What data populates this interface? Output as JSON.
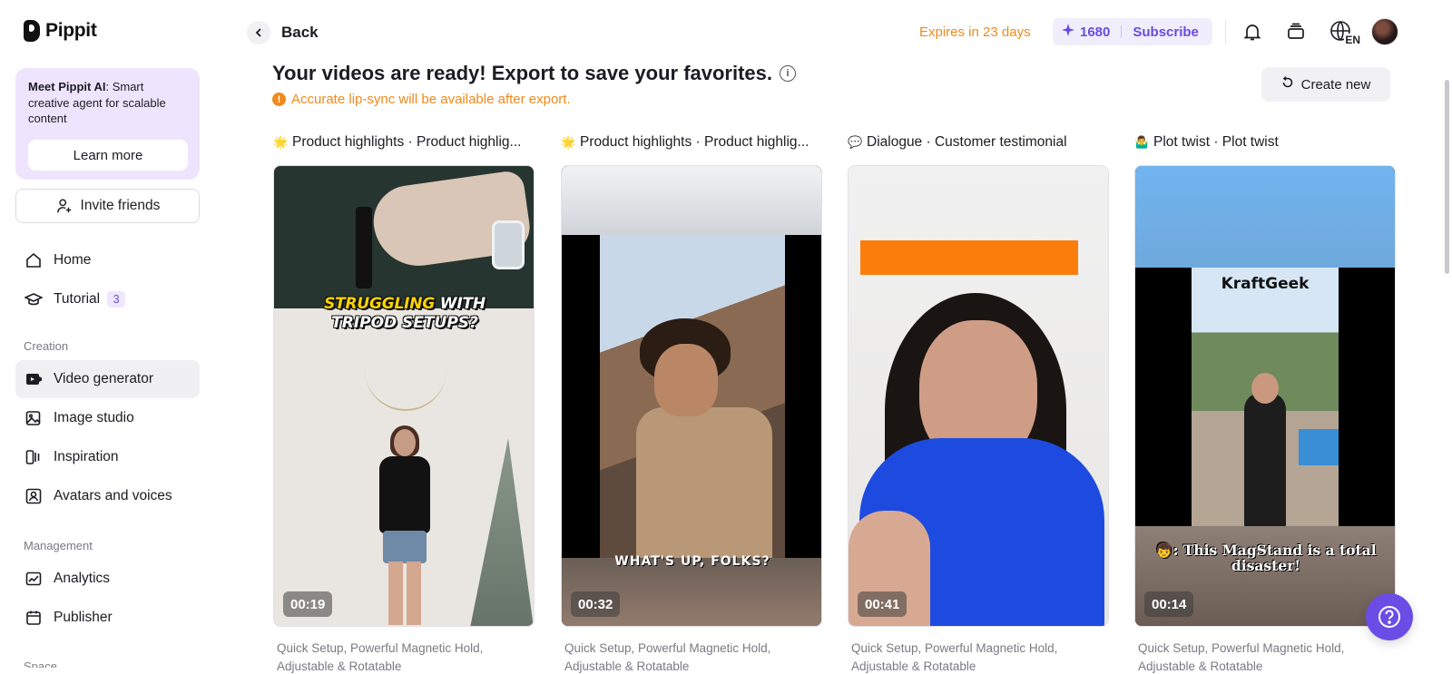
{
  "app": {
    "name": "Pippit"
  },
  "sidebar": {
    "promo": {
      "title_bold": "Meet Pippit AI",
      "text": ": Smart creative agent for scalable content",
      "button": "Learn more"
    },
    "invite_label": "Invite friends",
    "nav": [
      {
        "label": "Home",
        "icon": "home-icon"
      },
      {
        "label": "Tutorial",
        "icon": "graduation-cap-icon",
        "badge": "3"
      }
    ],
    "section_creation": "Creation",
    "creation": [
      {
        "label": "Video generator",
        "icon": "video-generator-icon",
        "active": true
      },
      {
        "label": "Image studio",
        "icon": "image-studio-icon"
      },
      {
        "label": "Inspiration",
        "icon": "inspiration-icon"
      },
      {
        "label": "Avatars and voices",
        "icon": "avatar-icon"
      }
    ],
    "section_management": "Management",
    "management": [
      {
        "label": "Analytics",
        "icon": "analytics-icon"
      },
      {
        "label": "Publisher",
        "icon": "calendar-icon"
      }
    ],
    "section_space_partial": "Space"
  },
  "topbar": {
    "back_label": "Back",
    "expires": "Expires in 23 days",
    "credits": "1680",
    "subscribe": "Subscribe",
    "language": "EN"
  },
  "main": {
    "headline": "Your videos are ready! Export to save your favorites.",
    "warning": "Accurate lip-sync will be available after export.",
    "create_new": "Create new",
    "cards": [
      {
        "emoji": "🌟",
        "title": "Product highlights · Product highlig...",
        "duration": "00:19",
        "desc": "Quick Setup, Powerful Magnetic Hold, Adjustable & Rotatable",
        "caption_a": "STRUGGLING",
        "caption_b": " WITH",
        "caption_c": "TRIPOD SETUPS?"
      },
      {
        "emoji": "🌟",
        "title": "Product highlights · Product highlig...",
        "duration": "00:32",
        "desc": "Quick Setup, Powerful Magnetic Hold, Adjustable & Rotatable",
        "caption": "WHAT'S UP, FOLKS?"
      },
      {
        "emoji": "💬",
        "title": "Dialogue · Customer testimonial",
        "duration": "00:41",
        "desc": "Quick Setup, Powerful Magnetic Hold, Adjustable & Rotatable"
      },
      {
        "emoji": "🤷‍♂️",
        "title": "Plot twist · Plot twist",
        "duration": "00:14",
        "desc": "Quick Setup, Powerful Magnetic Hold, Adjustable & Rotatable",
        "brand": "KraftGeek",
        "caption": "👦: This MagStand is a total disaster!"
      }
    ]
  },
  "colors": {
    "accent": "#6b4de6",
    "warning": "#f08a1d",
    "promo_bg": "#efe4fd"
  }
}
